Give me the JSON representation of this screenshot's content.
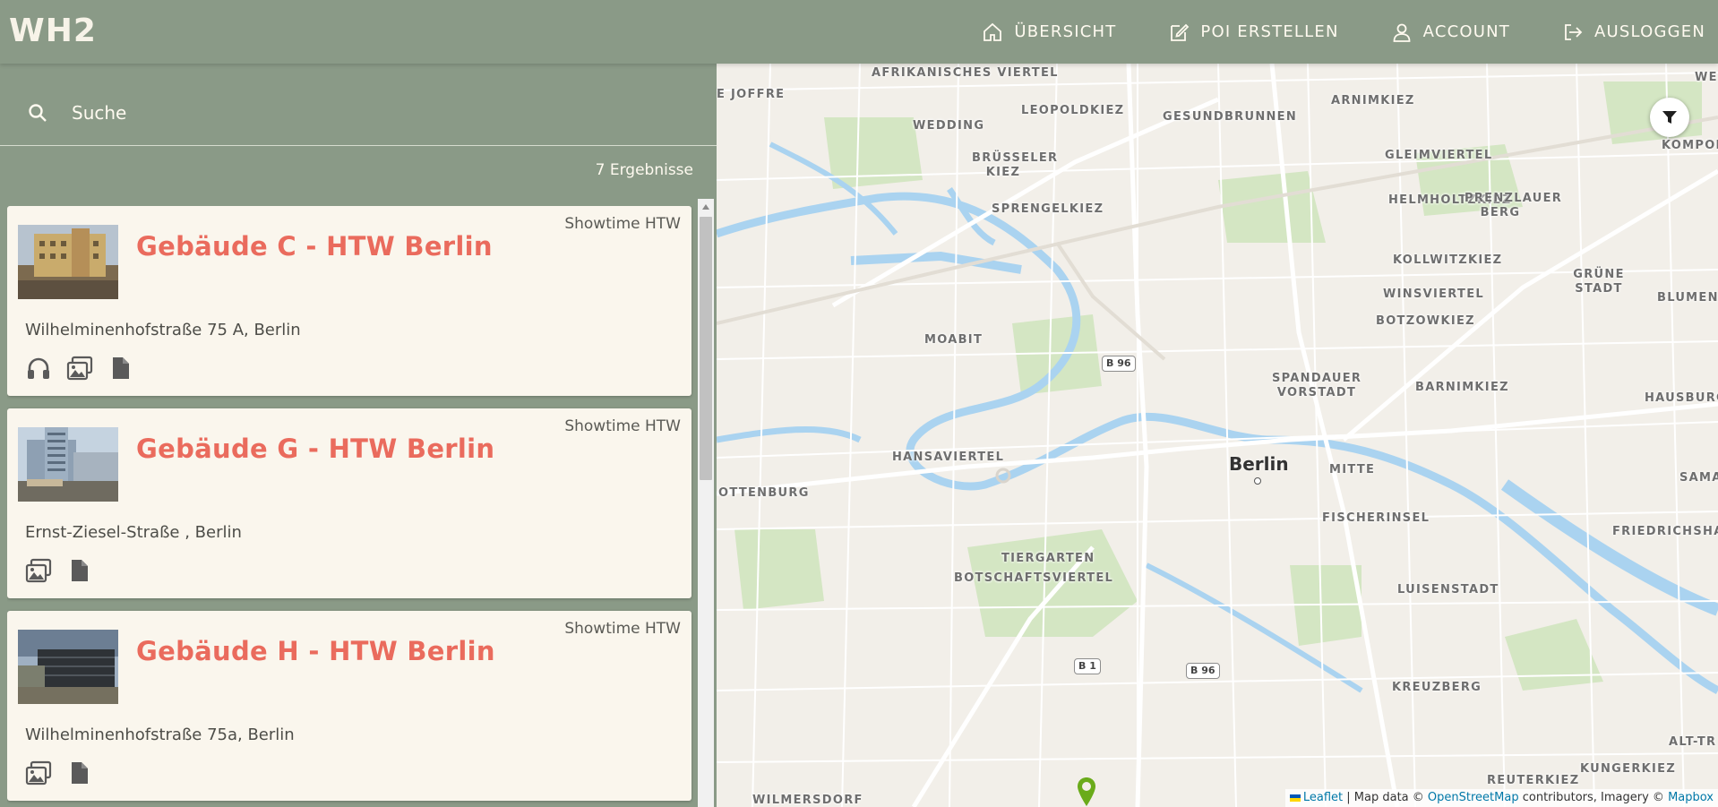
{
  "app": {
    "logo": "WH2"
  },
  "nav": {
    "items": [
      {
        "label": "ÜBERSICHT",
        "icon": "home-icon"
      },
      {
        "label": "POI ERSTELLEN",
        "icon": "edit-icon"
      },
      {
        "label": "ACCOUNT",
        "icon": "user-icon"
      },
      {
        "label": "AUSLOGGEN",
        "icon": "logout-icon"
      }
    ]
  },
  "search": {
    "placeholder": "Suche"
  },
  "results": {
    "count_label": "7 Ergebnisse"
  },
  "cards": [
    {
      "title": "Gebäude C - HTW Berlin",
      "tag": "Showtime HTW",
      "address": "Wilhelminenhofstraße 75 A, Berlin",
      "media": [
        "audio-icon",
        "image-icon",
        "document-icon"
      ]
    },
    {
      "title": "Gebäude G - HTW Berlin",
      "tag": "Showtime HTW",
      "address": "Ernst-Ziesel-Straße , Berlin",
      "media": [
        "image-icon",
        "document-icon"
      ]
    },
    {
      "title": "Gebäude H - HTW Berlin",
      "tag": "Showtime HTW",
      "address": "Wilhelminenhofstraße 75a, Berlin",
      "media": [
        "image-icon",
        "document-icon"
      ]
    }
  ],
  "map": {
    "districts": [
      "AFRIKANISCHES VIERTEL",
      "LEOPOLDKIEZ",
      "GESUNDBRUNNEN",
      "ARNIMKIEZ",
      "WEDDING",
      "BRÜSSELER KIEZ",
      "GLEIMVIERTEL",
      "SPRENGELKIEZ",
      "HELMHOLTZKIEZ",
      "PRENZLAUER BERG",
      "KOLLWITZKIEZ",
      "GRÜNE STADT",
      "WINSVIERTEL",
      "BLUMENV",
      "BOTZOWKIEZ",
      "MOABIT",
      "SPANDAUER VORSTADT",
      "BARNIMKIEZ",
      "HAUSBURGVIER",
      "HANSAVIERTEL",
      "MITTE",
      "OTTENBURG",
      "FISCHERINSEL",
      "FRIEDRICHSHAIN",
      "TIERGARTEN",
      "BOTSCHAFTSVIERTEL",
      "LUISENSTADT",
      "KREUZBERG",
      "ALT-TR",
      "KUNGERKIEZ",
      "REUTERKIEZ",
      "WILMERSDORF",
      "KOMPONISTE",
      "E JOFFRE",
      "SAMA",
      "WE"
    ],
    "city": "Berlin",
    "roads": [
      "B 96",
      "B 96",
      "B 1"
    ],
    "attribution": {
      "leaflet": "Leaflet",
      "sep1": " | Map data © ",
      "osm": "OpenStreetMap",
      "sep2": " contributors, Imagery © ",
      "mapbox": "Mapbox"
    }
  },
  "colors": {
    "header_bg": "#8a9a87",
    "title_accent": "#ea6b5d",
    "card_bg": "#faf6ed",
    "marker": "#6aab1a"
  }
}
